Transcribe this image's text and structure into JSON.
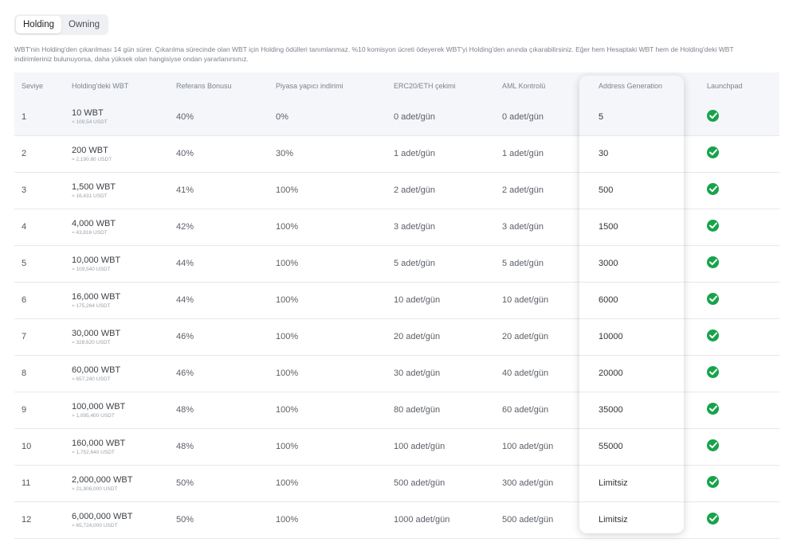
{
  "tabs": [
    {
      "label": "Holding",
      "active": true
    },
    {
      "label": "Owning",
      "active": false
    }
  ],
  "note": "WBT'nin Holding'den çıkarılması 14 gün sürer. Çıkarılma sürecinde olan WBT için Holding ödülleri tanımlanmaz. %10 komisyon ücreti ödeyerek WBT'yi Holding'den anında çıkarabilirsiniz. Eğer hem Hesaptaki WBT hem de Holding'deki WBT indirimleriniz bulunuyorsa, daha yüksek olan hangisiyse ondan yararlanırsınız.",
  "columns": [
    "Seviye",
    "Holding'deki WBT",
    "Referans Bonusu",
    "Piyasa yapıcı indirimi",
    "ERC20/ETH çekimi",
    "AML Kontrolü",
    "Address Generation",
    "Launchpad"
  ],
  "rows": [
    {
      "level": "1",
      "wbt": "10 WBT",
      "usdt": "≈ 109,54 USDT",
      "ref": "40%",
      "mm": "0%",
      "erc": "0 adet/gün",
      "aml": "0 adet/gün",
      "addr": "5"
    },
    {
      "level": "2",
      "wbt": "200 WBT",
      "usdt": "≈ 2,190.80 USDT",
      "ref": "40%",
      "mm": "30%",
      "erc": "1 adet/gün",
      "aml": "1 adet/gün",
      "addr": "30"
    },
    {
      "level": "3",
      "wbt": "1,500 WBT",
      "usdt": "≈ 16,431 USDT",
      "ref": "41%",
      "mm": "100%",
      "erc": "2 adet/gün",
      "aml": "2 adet/gün",
      "addr": "500"
    },
    {
      "level": "4",
      "wbt": "4,000 WBT",
      "usdt": "≈ 43,816 USDT",
      "ref": "42%",
      "mm": "100%",
      "erc": "3 adet/gün",
      "aml": "3 adet/gün",
      "addr": "1500"
    },
    {
      "level": "5",
      "wbt": "10,000 WBT",
      "usdt": "≈ 109,540 USDT",
      "ref": "44%",
      "mm": "100%",
      "erc": "5 adet/gün",
      "aml": "5 adet/gün",
      "addr": "3000"
    },
    {
      "level": "6",
      "wbt": "16,000 WBT",
      "usdt": "≈ 175,264 USDT",
      "ref": "44%",
      "mm": "100%",
      "erc": "10 adet/gün",
      "aml": "10 adet/gün",
      "addr": "6000"
    },
    {
      "level": "7",
      "wbt": "30,000 WBT",
      "usdt": "≈ 328,620 USDT",
      "ref": "46%",
      "mm": "100%",
      "erc": "20 adet/gün",
      "aml": "20 adet/gün",
      "addr": "10000"
    },
    {
      "level": "8",
      "wbt": "60,000 WBT",
      "usdt": "≈ 657,240 USDT",
      "ref": "46%",
      "mm": "100%",
      "erc": "30 adet/gün",
      "aml": "40 adet/gün",
      "addr": "20000"
    },
    {
      "level": "9",
      "wbt": "100,000 WBT",
      "usdt": "≈ 1,095,400 USDT",
      "ref": "48%",
      "mm": "100%",
      "erc": "80 adet/gün",
      "aml": "60 adet/gün",
      "addr": "35000"
    },
    {
      "level": "10",
      "wbt": "160,000 WBT",
      "usdt": "≈ 1,752,640 USDT",
      "ref": "48%",
      "mm": "100%",
      "erc": "100 adet/gün",
      "aml": "100 adet/gün",
      "addr": "55000"
    },
    {
      "level": "11",
      "wbt": "2,000,000 WBT",
      "usdt": "≈ 21,908,000 USDT",
      "ref": "50%",
      "mm": "100%",
      "erc": "500 adet/gün",
      "aml": "300 adet/gün",
      "addr": "Limitsiz"
    },
    {
      "level": "12",
      "wbt": "6,000,000 WBT",
      "usdt": "≈ 65,724,000 USDT",
      "ref": "50%",
      "mm": "100%",
      "erc": "1000 adet/gün",
      "aml": "500 adet/gün",
      "addr": "Limitsiz"
    }
  ],
  "launchpad_icon": "check-circle-icon",
  "colors": {
    "check": "#17a34a",
    "header_bg": "#f4f6f9"
  }
}
